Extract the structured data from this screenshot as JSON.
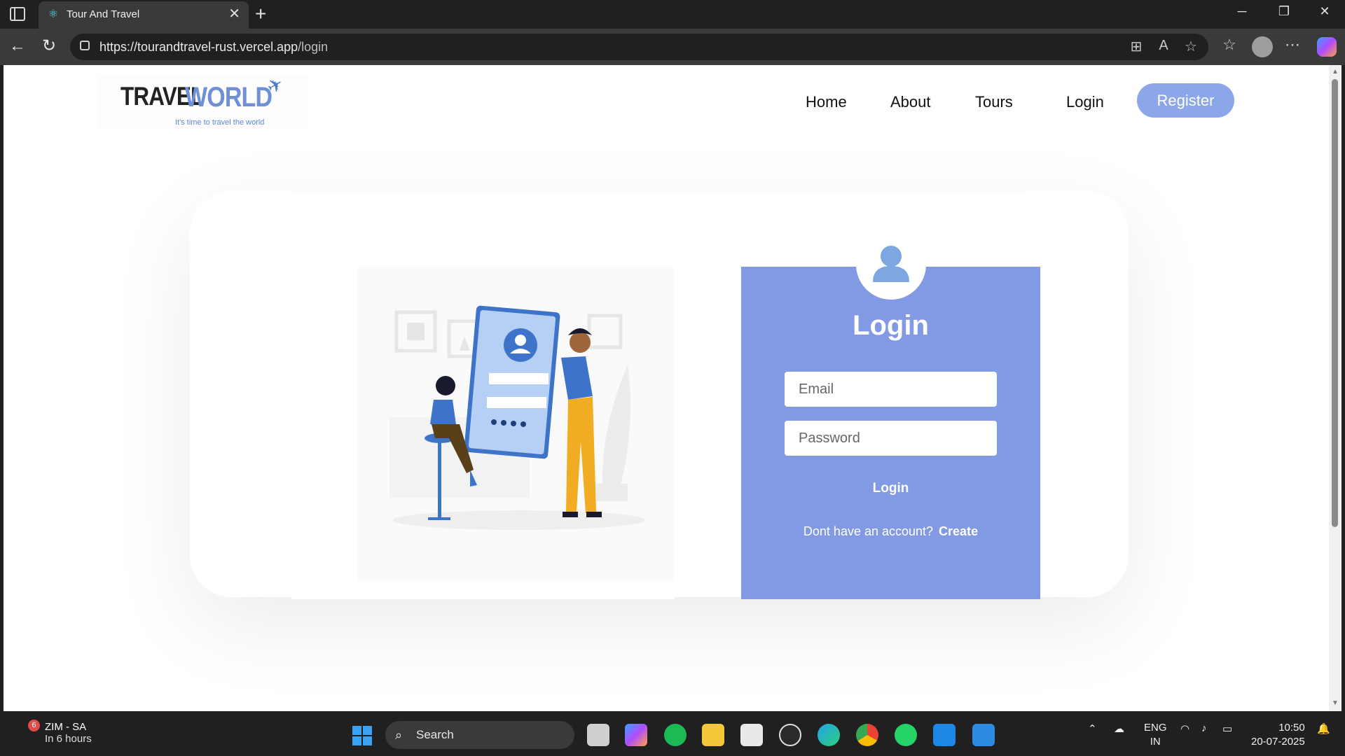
{
  "browser": {
    "tab_title": "Tour And Travel",
    "new_tab": "+",
    "close_tab": "✕",
    "url_host": "https://tourandtravel-rust.vercel.app",
    "url_path": "/login"
  },
  "site": {
    "logo_travel": "TRAVEL",
    "logo_world": "WORLD",
    "logo_tagline": "It's time to travel the world",
    "nav": {
      "home": "Home",
      "about": "About",
      "tours": "Tours",
      "login": "Login",
      "register": "Register"
    }
  },
  "login_form": {
    "title": "Login",
    "email_placeholder": "Email",
    "password_placeholder": "Password",
    "submit_label": "Login",
    "no_account_text": "Dont have an account?",
    "create_link": "Create"
  },
  "taskbar": {
    "weather_title": "ZIM - SA",
    "weather_sub": "In 6 hours",
    "weather_badge": "6",
    "search_label": "Search",
    "lang_line1": "ENG",
    "lang_line2": "IN",
    "time": "10:50",
    "date": "20-07-2025"
  },
  "colors": {
    "accent": "#8299e3",
    "register_button": "#8ca6ea",
    "browser_chrome": "#202020"
  }
}
